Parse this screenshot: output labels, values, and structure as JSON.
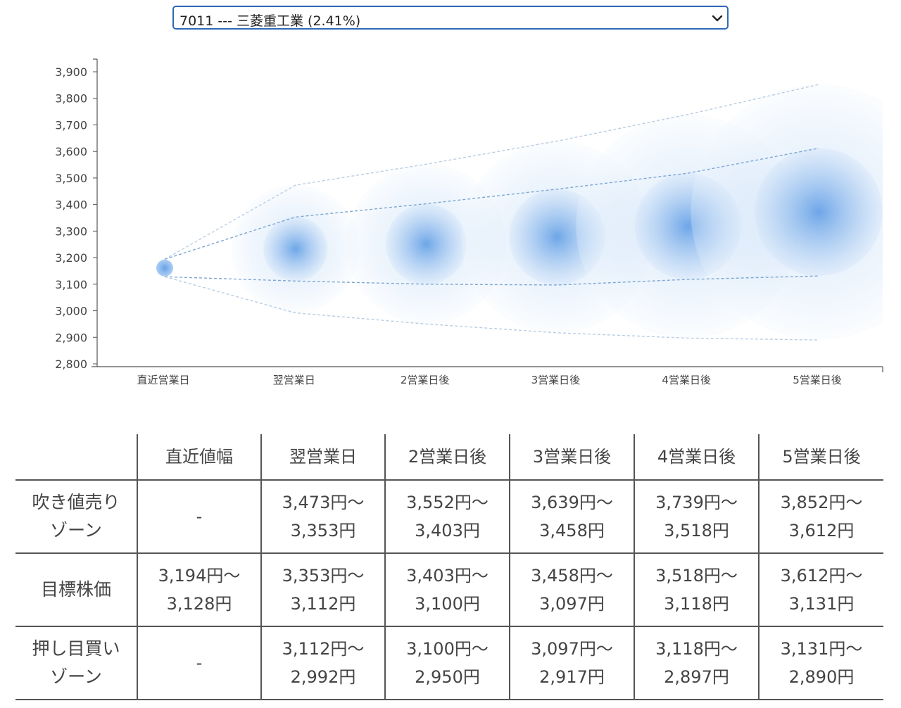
{
  "stock_select": {
    "value": "7011 --- 三菱重工業 (2.41%)"
  },
  "chart_data": {
    "type": "scatter",
    "categories": [
      "直近営業日",
      "翌営業日",
      "2営業日後",
      "3営業日後",
      "4営業日後",
      "5営業日後"
    ],
    "ylim": [
      2800,
      3900
    ],
    "yticks": [
      2800,
      2900,
      3000,
      3100,
      3200,
      3300,
      3400,
      3500,
      3600,
      3700,
      3800,
      3900
    ],
    "center": [
      3161,
      3233,
      3251,
      3278,
      3318,
      3372
    ],
    "upper_outer": [
      3194,
      3473,
      3552,
      3639,
      3739,
      3852
    ],
    "upper_inner": [
      3194,
      3353,
      3403,
      3458,
      3518,
      3612
    ],
    "lower_inner": [
      3128,
      3112,
      3100,
      3097,
      3118,
      3131
    ],
    "lower_outer": [
      3128,
      2992,
      2950,
      2917,
      2897,
      2890
    ],
    "colors": {
      "bubble": "#4a90e2",
      "line": "#8fb4da",
      "axis": "#555555"
    }
  },
  "table": {
    "headers": [
      "",
      "直近値幅",
      "翌営業日",
      "2営業日後",
      "3営業日後",
      "4営業日後",
      "5営業日後"
    ],
    "rows": [
      {
        "label1": "吹き値売り",
        "label2": "ゾーン",
        "cells": [
          {
            "l1": "-",
            "l2": ""
          },
          {
            "l1": "3,473円〜",
            "l2": "3,353円"
          },
          {
            "l1": "3,552円〜",
            "l2": "3,403円"
          },
          {
            "l1": "3,639円〜",
            "l2": "3,458円"
          },
          {
            "l1": "3,739円〜",
            "l2": "3,518円"
          },
          {
            "l1": "3,852円〜",
            "l2": "3,612円"
          }
        ]
      },
      {
        "label1": "目標株価",
        "label2": "",
        "cells": [
          {
            "l1": "3,194円〜",
            "l2": "3,128円"
          },
          {
            "l1": "3,353円〜",
            "l2": "3,112円"
          },
          {
            "l1": "3,403円〜",
            "l2": "3,100円"
          },
          {
            "l1": "3,458円〜",
            "l2": "3,097円"
          },
          {
            "l1": "3,518円〜",
            "l2": "3,118円"
          },
          {
            "l1": "3,612円〜",
            "l2": "3,131円"
          }
        ]
      },
      {
        "label1": "押し目買い",
        "label2": "ゾーン",
        "cells": [
          {
            "l1": "-",
            "l2": ""
          },
          {
            "l1": "3,112円〜",
            "l2": "2,992円"
          },
          {
            "l1": "3,100円〜",
            "l2": "2,950円"
          },
          {
            "l1": "3,097円〜",
            "l2": "2,917円"
          },
          {
            "l1": "3,118円〜",
            "l2": "2,897円"
          },
          {
            "l1": "3,131円〜",
            "l2": "2,890円"
          }
        ]
      }
    ]
  }
}
